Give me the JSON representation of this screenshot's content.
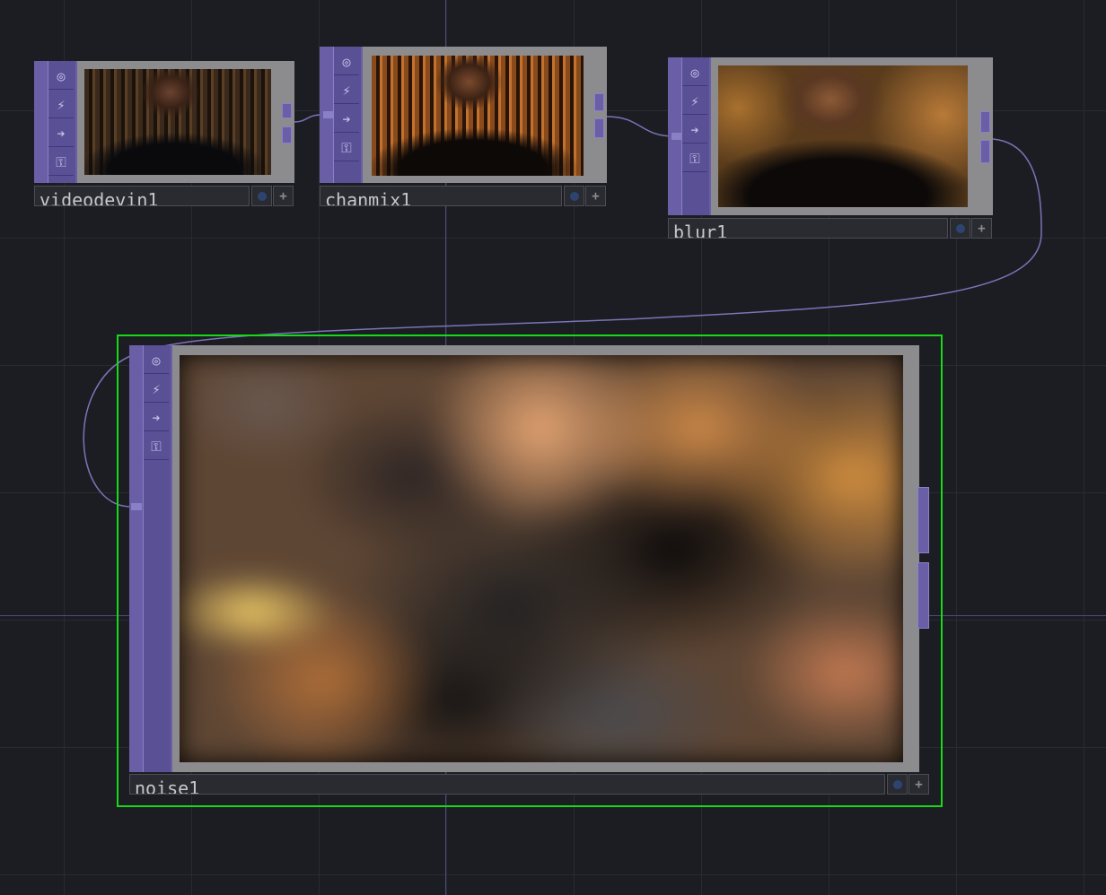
{
  "nodes": {
    "videodevin": {
      "name": "videodevin1"
    },
    "chanmix": {
      "name": "chanmix1"
    },
    "blur": {
      "name": "blur1"
    },
    "noise": {
      "name": "noise1",
      "selected": true
    }
  },
  "node_buttons": [
    {
      "icon": "viewer-icon",
      "glyph": "◎"
    },
    {
      "icon": "bypass-icon",
      "glyph": "⚡"
    },
    {
      "icon": "display-icon",
      "glyph": "➔"
    },
    {
      "icon": "lock-icon",
      "glyph": "🔓"
    }
  ],
  "flags": {
    "dot_color": "#2d4470",
    "plus": "+"
  },
  "colors": {
    "background": "#1c1d22",
    "grid": "#292b31",
    "axis": "#4a4a7e",
    "wire": "#7a74b8",
    "node_purple": "#6a5fa7",
    "selection": "#18d818"
  }
}
